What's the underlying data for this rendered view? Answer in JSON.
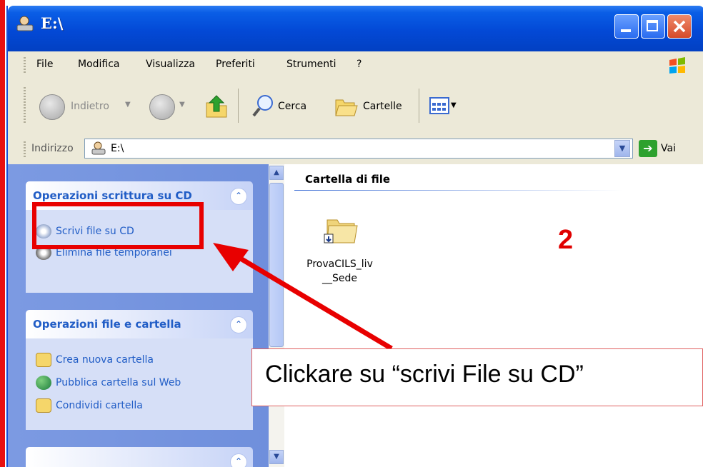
{
  "window": {
    "title": "E:\\"
  },
  "menu": [
    "File",
    "Modifica",
    "Visualizza",
    "Preferiti",
    "Strumenti",
    "?"
  ],
  "toolbar": {
    "back": "Indietro",
    "search": "Cerca",
    "folders": "Cartelle"
  },
  "address": {
    "label": "Indirizzo",
    "value": "E:\\",
    "go": "Vai"
  },
  "tasks": {
    "cd_panel": {
      "title": "Operazioni scrittura su CD",
      "items": [
        "Scrivi file su CD",
        "Elimina file temporanei"
      ]
    },
    "file_panel": {
      "title": "Operazioni file e cartella",
      "items": [
        "Crea nuova cartella",
        "Pubblica cartella sul Web",
        "Condividi cartella"
      ]
    }
  },
  "content": {
    "group_title": "Cartella di file",
    "item_label": "ProvaCILS_liv\n__Sede"
  },
  "annotation": {
    "step": "2",
    "text": "Clickare su “scrivi File su CD”",
    "color": "#e00000"
  },
  "colors": {
    "titlebar": "#0349d6",
    "task_link": "#215dc6",
    "task_pane": "#7c9ae2"
  }
}
